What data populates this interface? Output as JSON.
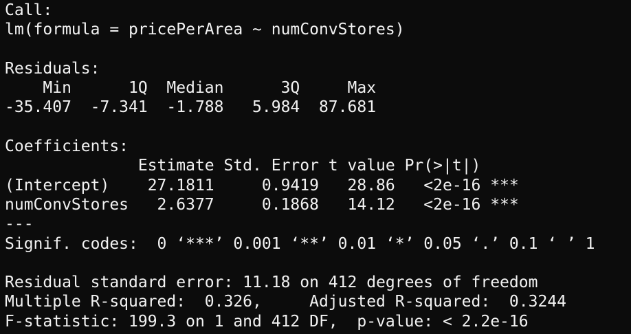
{
  "theme": {
    "background": "#0c0c0c",
    "foreground": "#f2f2f2"
  },
  "output": {
    "call_header": "Call:",
    "call_formula": "lm(formula = pricePerArea ~ numConvStores)",
    "residuals_header": "Residuals:",
    "residuals_labels": "    Min      1Q  Median      3Q     Max ",
    "residuals_values": "-35.407  -7.341  -1.788   5.984  87.681 ",
    "coefficients_header": "Coefficients:",
    "coef_columns": "              Estimate Std. Error t value Pr(>|t|)    ",
    "coef_rows": [
      "(Intercept)    27.1811     0.9419   28.86   <2e-16 ***",
      "numConvStores   2.6377     0.1868   14.12   <2e-16 ***"
    ],
    "separator": "---",
    "signif_codes": "Signif. codes:  0 ‘***’ 0.001 ‘**’ 0.01 ‘*’ 0.05 ‘.’ 0.1 ‘ ’ 1",
    "residual_se": "Residual standard error: 11.18 on 412 degrees of freedom",
    "r_squared": "Multiple R-squared:  0.326,\tAdjusted R-squared:  0.3244 ",
    "f_statistic": "F-statistic: 199.3 on 1 and 412 DF,  p-value: < 2.2e-16"
  }
}
